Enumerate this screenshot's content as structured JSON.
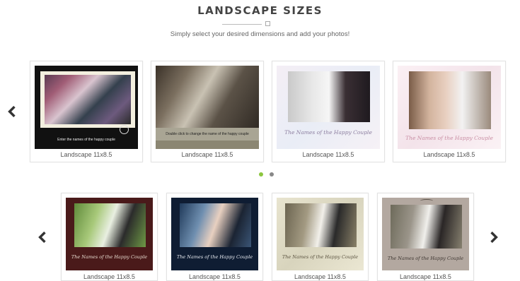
{
  "header": {
    "title": "LANDSCAPE SIZES",
    "subtitle": "Simply select your desired dimensions and add your photos!"
  },
  "carousel_top": {
    "cards": [
      {
        "caption": "Landscape 11x8.5",
        "frame_text": "Enter the names of the happy couple"
      },
      {
        "caption": "Landscape 11x8.5",
        "frame_text": "Double click to change the name of the happy couple"
      },
      {
        "caption": "Landscape 11x8.5",
        "frame_text": "The Names of the Happy Couple"
      },
      {
        "caption": "Landscape 11x8.5",
        "frame_text": "The Names of the Happy Couple"
      }
    ],
    "pager": {
      "active_index": 0,
      "count": 2,
      "active_color": "#8cc63f",
      "inactive_color": "#888888"
    }
  },
  "carousel_bottom": {
    "cards": [
      {
        "caption": "Landscape 11x8.5",
        "frame_text": "The Names of the Happy Couple"
      },
      {
        "caption": "Landscape 11x8.5",
        "frame_text": "The Names of the Happy Couple"
      },
      {
        "caption": "Landscape 11x8.5",
        "frame_text": "The Names of the Happy Couple"
      },
      {
        "caption": "Landscape 11x8.5",
        "frame_text": "The Names of the Happy Couple"
      }
    ]
  },
  "icons": {
    "prev": "chevron-left-icon",
    "next": "chevron-right-icon"
  }
}
